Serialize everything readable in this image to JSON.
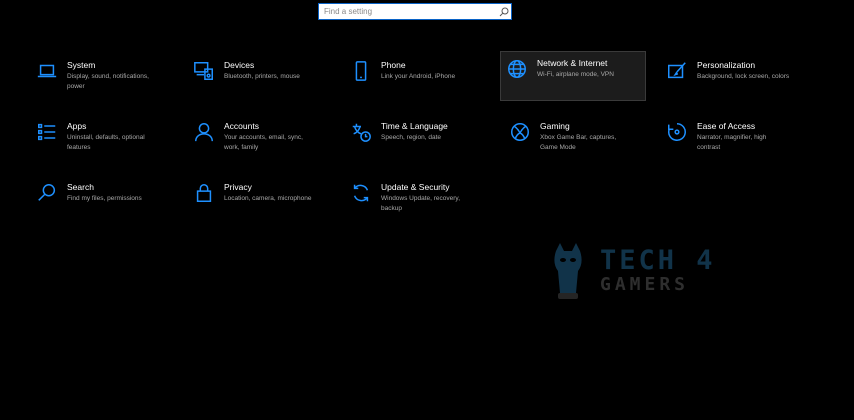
{
  "search": {
    "placeholder": "Find a setting"
  },
  "accent_color": "#1e90ff",
  "tiles": [
    {
      "title": "System",
      "desc": "Display, sound, notifications, power",
      "icon": "laptop-icon"
    },
    {
      "title": "Devices",
      "desc": "Bluetooth, printers, mouse",
      "icon": "devices-icon"
    },
    {
      "title": "Phone",
      "desc": "Link your Android, iPhone",
      "icon": "phone-icon"
    },
    {
      "title": "Network & Internet",
      "desc": "Wi-Fi, airplane mode, VPN",
      "icon": "globe-icon"
    },
    {
      "title": "Personalization",
      "desc": "Background, lock screen, colors",
      "icon": "paint-icon"
    },
    {
      "title": "Apps",
      "desc": "Uninstall, defaults, optional features",
      "icon": "apps-list-icon"
    },
    {
      "title": "Accounts",
      "desc": "Your accounts, email, sync, work, family",
      "icon": "person-icon"
    },
    {
      "title": "Time & Language",
      "desc": "Speech, region, date",
      "icon": "time-language-icon"
    },
    {
      "title": "Gaming",
      "desc": "Xbox Game Bar, captures, Game Mode",
      "icon": "xbox-icon"
    },
    {
      "title": "Ease of Access",
      "desc": "Narrator, magnifier, high contrast",
      "icon": "ease-of-access-icon"
    },
    {
      "title": "Search",
      "desc": "Find my files, permissions",
      "icon": "search-icon"
    },
    {
      "title": "Privacy",
      "desc": "Location, camera, microphone",
      "icon": "lock-icon"
    },
    {
      "title": "Update & Security",
      "desc": "Windows Update, recovery, backup",
      "icon": "update-icon"
    }
  ],
  "watermark": {
    "line1": "TECH 4",
    "line2": "GAMERS"
  }
}
